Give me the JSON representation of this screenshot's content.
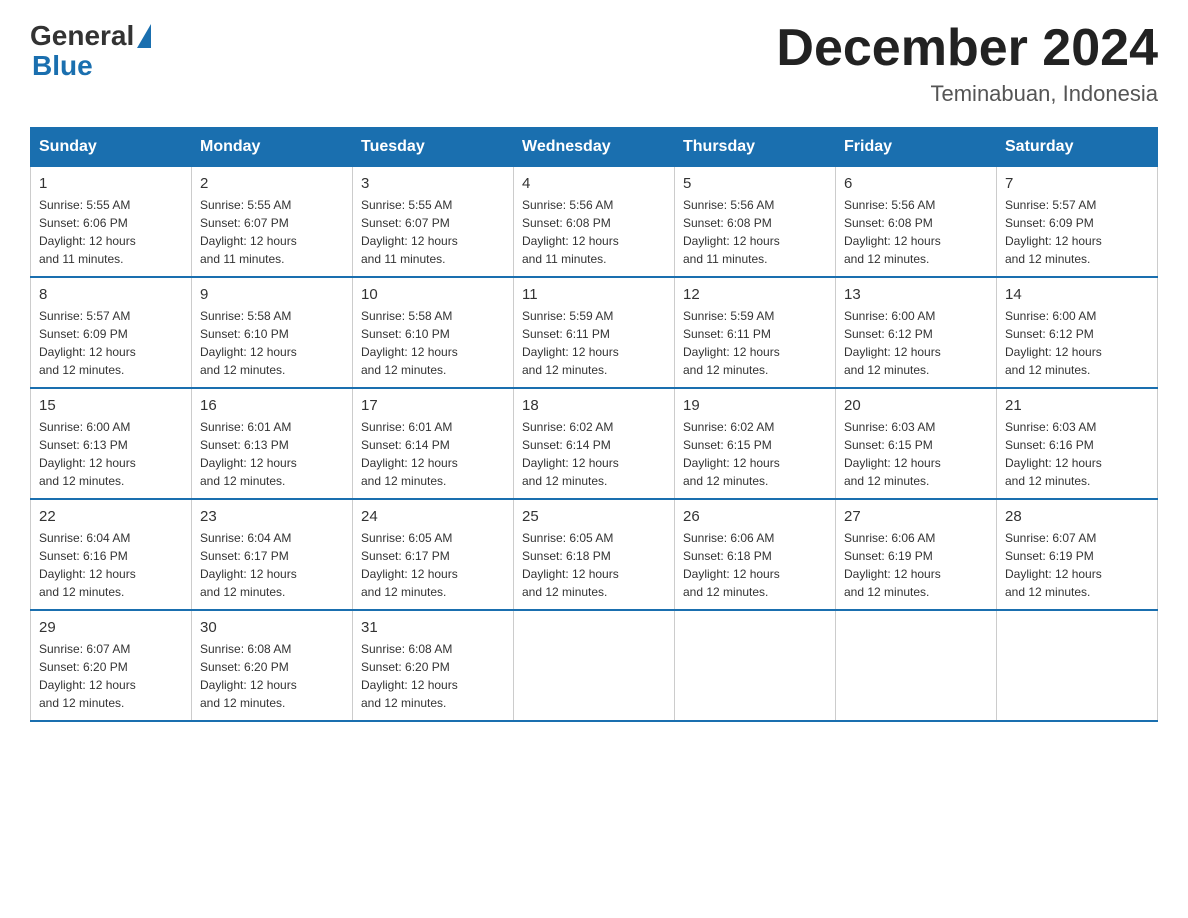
{
  "logo": {
    "general": "General",
    "blue": "Blue"
  },
  "title": "December 2024",
  "location": "Teminabuan, Indonesia",
  "days_header": [
    "Sunday",
    "Monday",
    "Tuesday",
    "Wednesday",
    "Thursday",
    "Friday",
    "Saturday"
  ],
  "weeks": [
    [
      {
        "num": "1",
        "info": "Sunrise: 5:55 AM\nSunset: 6:06 PM\nDaylight: 12 hours\nand 11 minutes."
      },
      {
        "num": "2",
        "info": "Sunrise: 5:55 AM\nSunset: 6:07 PM\nDaylight: 12 hours\nand 11 minutes."
      },
      {
        "num": "3",
        "info": "Sunrise: 5:55 AM\nSunset: 6:07 PM\nDaylight: 12 hours\nand 11 minutes."
      },
      {
        "num": "4",
        "info": "Sunrise: 5:56 AM\nSunset: 6:08 PM\nDaylight: 12 hours\nand 11 minutes."
      },
      {
        "num": "5",
        "info": "Sunrise: 5:56 AM\nSunset: 6:08 PM\nDaylight: 12 hours\nand 11 minutes."
      },
      {
        "num": "6",
        "info": "Sunrise: 5:56 AM\nSunset: 6:08 PM\nDaylight: 12 hours\nand 12 minutes."
      },
      {
        "num": "7",
        "info": "Sunrise: 5:57 AM\nSunset: 6:09 PM\nDaylight: 12 hours\nand 12 minutes."
      }
    ],
    [
      {
        "num": "8",
        "info": "Sunrise: 5:57 AM\nSunset: 6:09 PM\nDaylight: 12 hours\nand 12 minutes."
      },
      {
        "num": "9",
        "info": "Sunrise: 5:58 AM\nSunset: 6:10 PM\nDaylight: 12 hours\nand 12 minutes."
      },
      {
        "num": "10",
        "info": "Sunrise: 5:58 AM\nSunset: 6:10 PM\nDaylight: 12 hours\nand 12 minutes."
      },
      {
        "num": "11",
        "info": "Sunrise: 5:59 AM\nSunset: 6:11 PM\nDaylight: 12 hours\nand 12 minutes."
      },
      {
        "num": "12",
        "info": "Sunrise: 5:59 AM\nSunset: 6:11 PM\nDaylight: 12 hours\nand 12 minutes."
      },
      {
        "num": "13",
        "info": "Sunrise: 6:00 AM\nSunset: 6:12 PM\nDaylight: 12 hours\nand 12 minutes."
      },
      {
        "num": "14",
        "info": "Sunrise: 6:00 AM\nSunset: 6:12 PM\nDaylight: 12 hours\nand 12 minutes."
      }
    ],
    [
      {
        "num": "15",
        "info": "Sunrise: 6:00 AM\nSunset: 6:13 PM\nDaylight: 12 hours\nand 12 minutes."
      },
      {
        "num": "16",
        "info": "Sunrise: 6:01 AM\nSunset: 6:13 PM\nDaylight: 12 hours\nand 12 minutes."
      },
      {
        "num": "17",
        "info": "Sunrise: 6:01 AM\nSunset: 6:14 PM\nDaylight: 12 hours\nand 12 minutes."
      },
      {
        "num": "18",
        "info": "Sunrise: 6:02 AM\nSunset: 6:14 PM\nDaylight: 12 hours\nand 12 minutes."
      },
      {
        "num": "19",
        "info": "Sunrise: 6:02 AM\nSunset: 6:15 PM\nDaylight: 12 hours\nand 12 minutes."
      },
      {
        "num": "20",
        "info": "Sunrise: 6:03 AM\nSunset: 6:15 PM\nDaylight: 12 hours\nand 12 minutes."
      },
      {
        "num": "21",
        "info": "Sunrise: 6:03 AM\nSunset: 6:16 PM\nDaylight: 12 hours\nand 12 minutes."
      }
    ],
    [
      {
        "num": "22",
        "info": "Sunrise: 6:04 AM\nSunset: 6:16 PM\nDaylight: 12 hours\nand 12 minutes."
      },
      {
        "num": "23",
        "info": "Sunrise: 6:04 AM\nSunset: 6:17 PM\nDaylight: 12 hours\nand 12 minutes."
      },
      {
        "num": "24",
        "info": "Sunrise: 6:05 AM\nSunset: 6:17 PM\nDaylight: 12 hours\nand 12 minutes."
      },
      {
        "num": "25",
        "info": "Sunrise: 6:05 AM\nSunset: 6:18 PM\nDaylight: 12 hours\nand 12 minutes."
      },
      {
        "num": "26",
        "info": "Sunrise: 6:06 AM\nSunset: 6:18 PM\nDaylight: 12 hours\nand 12 minutes."
      },
      {
        "num": "27",
        "info": "Sunrise: 6:06 AM\nSunset: 6:19 PM\nDaylight: 12 hours\nand 12 minutes."
      },
      {
        "num": "28",
        "info": "Sunrise: 6:07 AM\nSunset: 6:19 PM\nDaylight: 12 hours\nand 12 minutes."
      }
    ],
    [
      {
        "num": "29",
        "info": "Sunrise: 6:07 AM\nSunset: 6:20 PM\nDaylight: 12 hours\nand 12 minutes."
      },
      {
        "num": "30",
        "info": "Sunrise: 6:08 AM\nSunset: 6:20 PM\nDaylight: 12 hours\nand 12 minutes."
      },
      {
        "num": "31",
        "info": "Sunrise: 6:08 AM\nSunset: 6:20 PM\nDaylight: 12 hours\nand 12 minutes."
      },
      null,
      null,
      null,
      null
    ]
  ]
}
